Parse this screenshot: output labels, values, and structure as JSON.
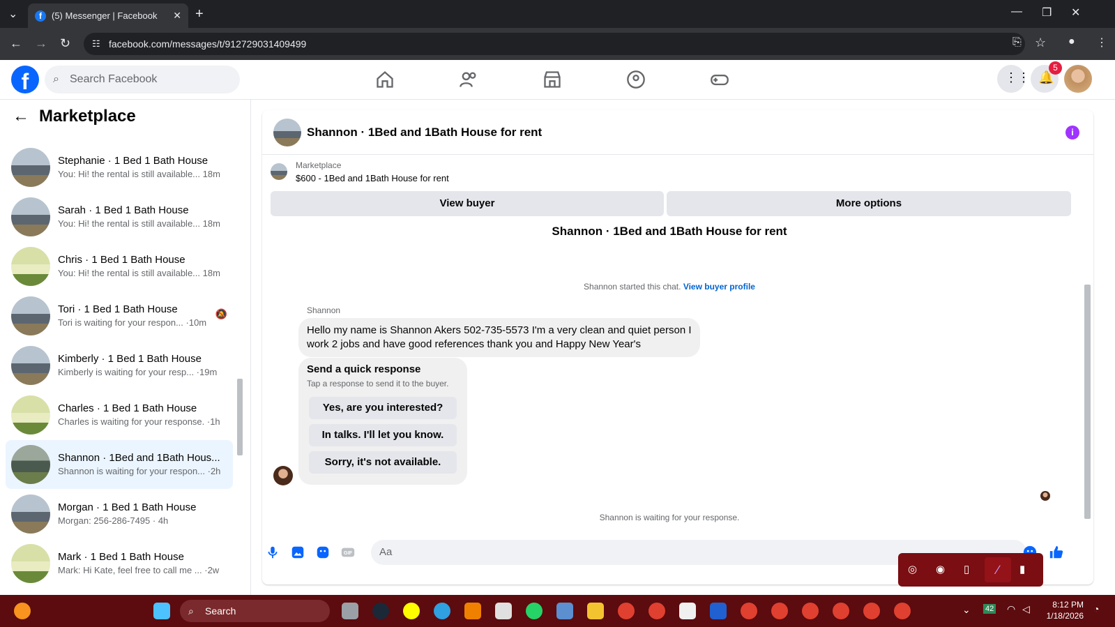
{
  "browser": {
    "tab_title": "(5) Messenger | Facebook",
    "url": "facebook.com/messages/t/912729031409499"
  },
  "facebook": {
    "search_placeholder": "Search Facebook",
    "notification_count": "5"
  },
  "sidebar": {
    "title": "Marketplace",
    "conversations": [
      {
        "name": "Stephanie · 1 Bed 1 Bath House",
        "snippet": "You: Hi! the rental is still available... 18m"
      },
      {
        "name": "Sarah · 1 Bed 1 Bath House",
        "snippet": "You: Hi! the rental is still available... 18m"
      },
      {
        "name": "Chris · 1 Bed 1 Bath House",
        "snippet": "You: Hi! the rental is still available... 18m"
      },
      {
        "name": "Tori · 1 Bed 1 Bath House",
        "snippet": "Tori is waiting for your respon... ·10m"
      },
      {
        "name": "Kimberly · 1 Bed 1 Bath House",
        "snippet": "Kimberly is waiting for your resp... ·19m"
      },
      {
        "name": "Charles · 1 Bed 1 Bath House",
        "snippet": "Charles is waiting for your response. ·1h"
      },
      {
        "name": "Shannon · 1Bed and 1Bath Hous...",
        "snippet": "Shannon is waiting for your respon... ·2h"
      },
      {
        "name": "Morgan · 1 Bed 1 Bath House",
        "snippet": "Morgan: 256-286-7495 · 4h"
      },
      {
        "name": "Mark · 1 Bed 1 Bath House",
        "snippet": "Mark: Hi Kate, feel free to call me ... ·2w"
      }
    ]
  },
  "chat": {
    "header_title": "Shannon · 1Bed and 1Bath House for rent",
    "marketplace_label": "Marketplace",
    "listing": "$600 - 1Bed and 1Bath House for rent",
    "view_buyer": "View buyer",
    "more_options": "More options",
    "conversation_title": "Shannon · 1Bed and 1Bath House for rent",
    "started_text": "Shannon started this chat.",
    "view_buyer_profile": "View buyer profile",
    "sender": "Shannon",
    "message": "Hello my name is Shannon Akers 502-735-5573 I'm a very clean and quiet person I work 2 jobs and have good references thank you and Happy New Year's",
    "quick_title": "Send a quick response",
    "quick_sub": "Tap a response to send it to the buyer.",
    "quick_replies": [
      "Yes, are you interested?",
      "In talks. I'll let you know.",
      "Sorry, it's not available."
    ],
    "waiting": "Shannon is waiting for your response.",
    "input_placeholder": "Aa"
  },
  "taskbar": {
    "search": "Search",
    "time": "8:12 PM",
    "date": "1/18/2026",
    "tray_number": "42"
  },
  "colors": {
    "fb_blue": "#0866ff",
    "taskbar": "#5c0b0e",
    "accent_purple": "#a033ff"
  }
}
